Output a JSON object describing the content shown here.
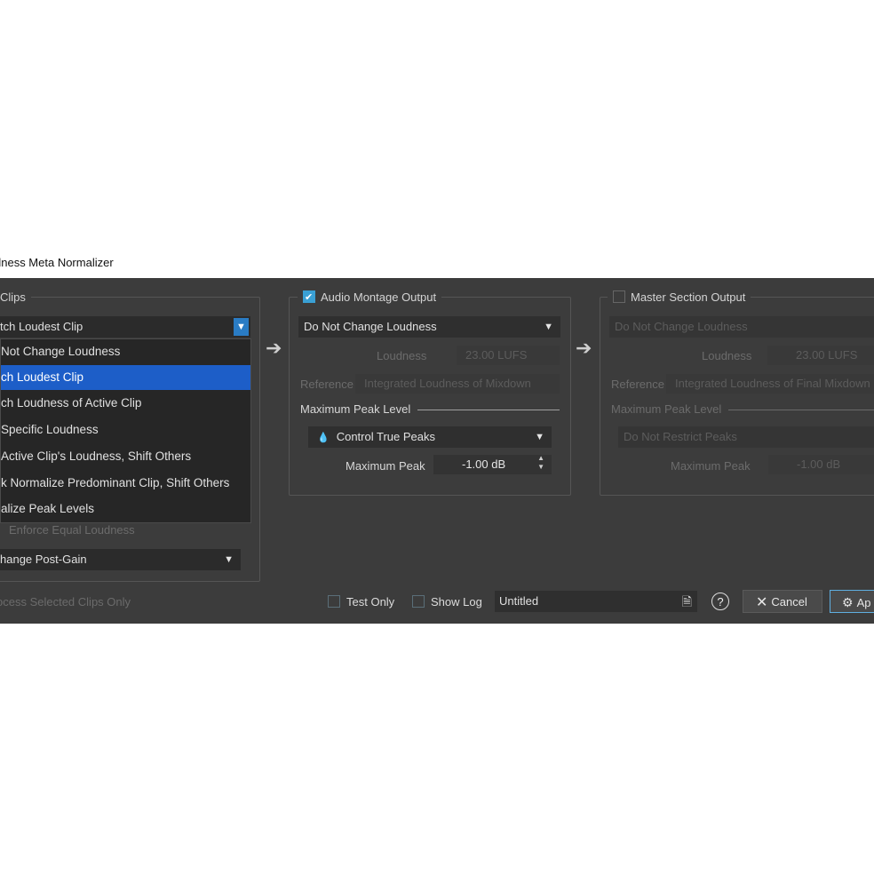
{
  "window": {
    "title": "dness Meta Normalizer"
  },
  "clips_group": {
    "title": "Clips",
    "mode_combo": "tch Loudest Clip",
    "menu": [
      {
        "label": "Not Change Loudness",
        "selected": false
      },
      {
        "label": "ch Loudest Clip",
        "selected": true
      },
      {
        "label": "ch Loudness of Active Clip",
        "selected": false
      },
      {
        "label": "Specific Loudness",
        "selected": false
      },
      {
        "label": "Active Clip's Loudness, Shift Others",
        "selected": false
      },
      {
        "label": "k Normalize Predominant Clip, Shift Others",
        "selected": false
      },
      {
        "label": "alize Peak Levels",
        "selected": false
      }
    ],
    "enforce_label": "Enforce Equal Loudness",
    "post_gain_combo": "hange Post-Gain"
  },
  "process_selected_label": "ocess Selected Clips Only",
  "montage_group": {
    "title": "Audio Montage Output",
    "checked": true,
    "loudness_combo": "Do Not Change Loudness",
    "loudness_label": "Loudness",
    "loudness_value": "23.00 LUFS",
    "reference_label": "Reference",
    "reference_value": "Integrated Loudness of Mixdown",
    "peak_section": "Maximum Peak Level",
    "peak_combo": "Control True Peaks",
    "max_peak_label": "Maximum Peak",
    "max_peak_value": "-1.00 dB"
  },
  "master_group": {
    "title": "Master Section Output",
    "checked": false,
    "loudness_combo": "Do Not Change Loudness",
    "loudness_label": "Loudness",
    "loudness_value": "23.00 LUFS",
    "reference_label": "Reference",
    "reference_value": "Integrated Loudness of Final Mixdown",
    "peak_section": "Maximum Peak Level",
    "peak_combo": "Do Not Restrict Peaks",
    "max_peak_label": "Maximum Peak",
    "max_peak_value": "-1.00 dB"
  },
  "footer": {
    "test_only": "Test Only",
    "show_log": "Show Log",
    "preset_name": "Untitled",
    "help": "?",
    "cancel": "Cancel",
    "apply": "Ap"
  },
  "icons": [
    "arrow-right-icon",
    "drop-icon",
    "spin-icon",
    "document-icon",
    "help-icon",
    "close-icon",
    "gears-icon"
  ],
  "colors": {
    "accent": "#3aa0d4",
    "selection": "#1d5ec8",
    "dialog_bg": "#3c3c3c"
  }
}
